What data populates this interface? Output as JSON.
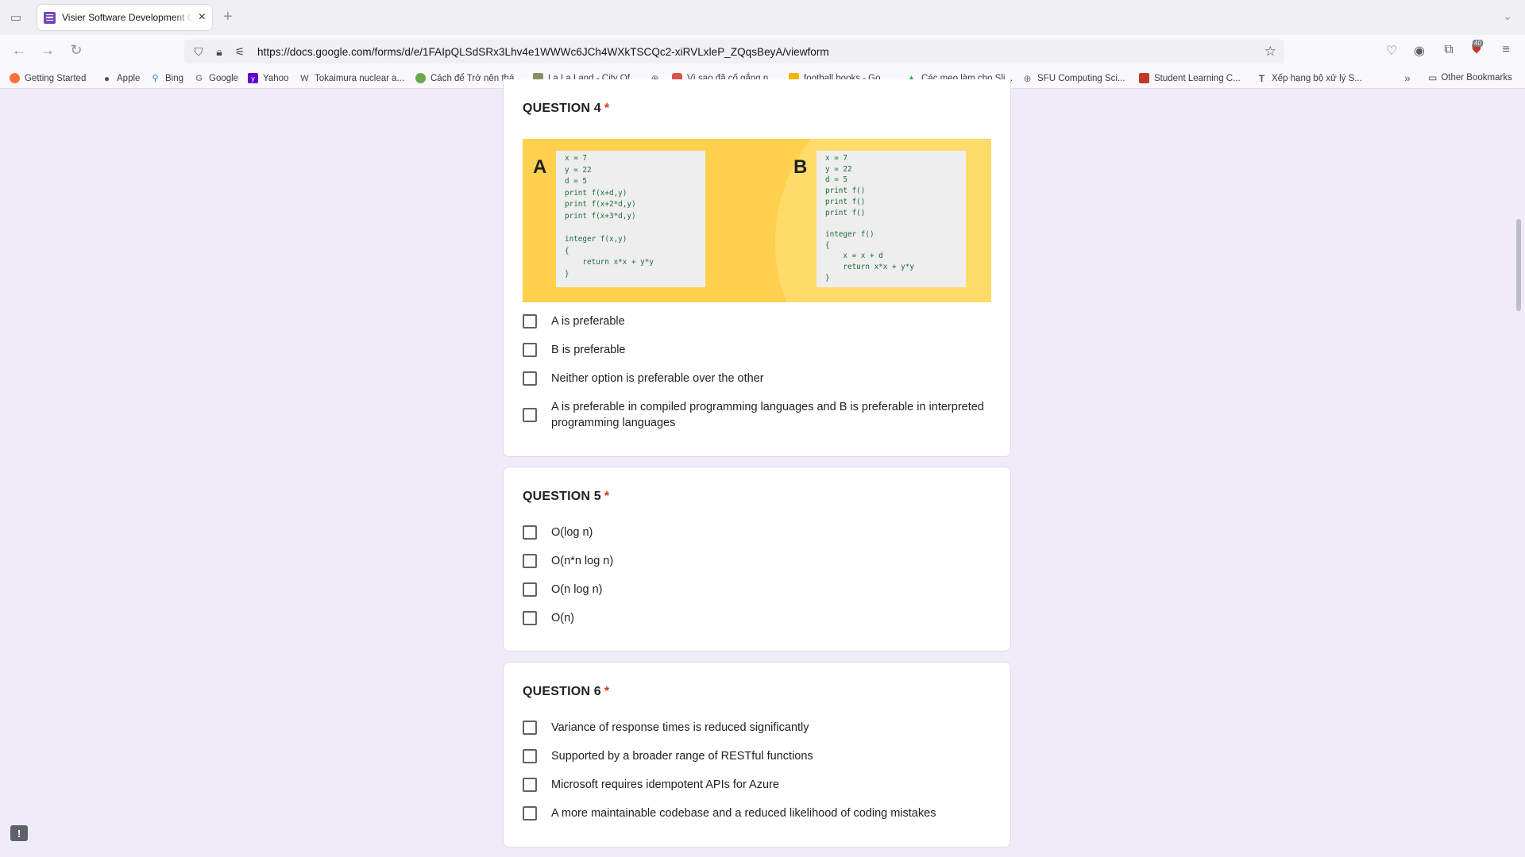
{
  "browser": {
    "tab_title": "Visier Software Development C...",
    "url": "https://docs.google.com/forms/d/e/1FAIpQLSdSRx3Lhv4e1WWWc6JCh4WXkTSCQc2-xiRVLxleP_ZQqsBeyA/viewform",
    "extension_badge": "40",
    "bookmarks": [
      {
        "label": "Getting Started",
        "color": "#ff7139"
      },
      {
        "label": "Apple",
        "color": "#555555"
      },
      {
        "label": "Bing",
        "color": "#2b7bd6"
      },
      {
        "label": "Google",
        "color": "#8a8a8a"
      },
      {
        "label": "Yahoo",
        "color": "#6001d2"
      },
      {
        "label": "Tokaimura nuclear a...",
        "color": "#444444"
      },
      {
        "label": "Cách để Trở nên thá...",
        "color": "#6aa84f"
      },
      {
        "label": "La La Land - City Of...",
        "color": "#8d8d6a"
      },
      {
        "label": "",
        "color": "#666666"
      },
      {
        "label": "Vì sao đã cố gắng n...",
        "color": "#d9534f"
      },
      {
        "label": "football books - Go...",
        "color": "#f4b400"
      },
      {
        "label": "Các mẹo làm cho Sli...",
        "color": "#34a853"
      },
      {
        "label": "SFU Computing Sci...",
        "color": "#777777"
      },
      {
        "label": "Student Learning C...",
        "color": "#c0392b"
      },
      {
        "label": "Xếp hạng bộ xử lý S...",
        "color": "#555555"
      }
    ],
    "other_bookmarks": "Other Bookmarks"
  },
  "questions": [
    {
      "title": "QUESTION 4",
      "required_mark": "*",
      "image": {
        "label_a": "A",
        "label_b": "B",
        "code_a": "x = 7\ny = 22\nd = 5\nprint f(x+d,y)\nprint f(x+2*d,y)\nprint f(x+3*d,y)\n\ninteger f(x,y)\n{\n    return x*x + y*y\n}",
        "code_b": "x = 7\ny = 22\nd = 5\nprint f()\nprint f()\nprint f()\n\ninteger f()\n{\n    x = x + d\n    return x*x + y*y\n}"
      },
      "options": [
        "A is preferable",
        "B is preferable",
        "Neither option is preferable over the other",
        "A is preferable in compiled programming languages and B is preferable in interpreted programming languages"
      ]
    },
    {
      "title": "QUESTION 5",
      "required_mark": "*",
      "options": [
        "O(log n)",
        "O(n*n log n)",
        "O(n log n)",
        "O(n)"
      ]
    },
    {
      "title": "QUESTION 6",
      "required_mark": "*",
      "options": [
        "Variance of response times is reduced significantly",
        "Supported by a broader range of RESTful functions",
        "Microsoft requires idempotent APIs for Azure",
        "A more maintainable codebase and a reduced likelihood of coding mistakes"
      ]
    }
  ],
  "colors": {
    "page_background": "#f0ebf8",
    "required": "#d93025",
    "image_background": "#ffd04d",
    "code_text": "#1d6b3a"
  }
}
